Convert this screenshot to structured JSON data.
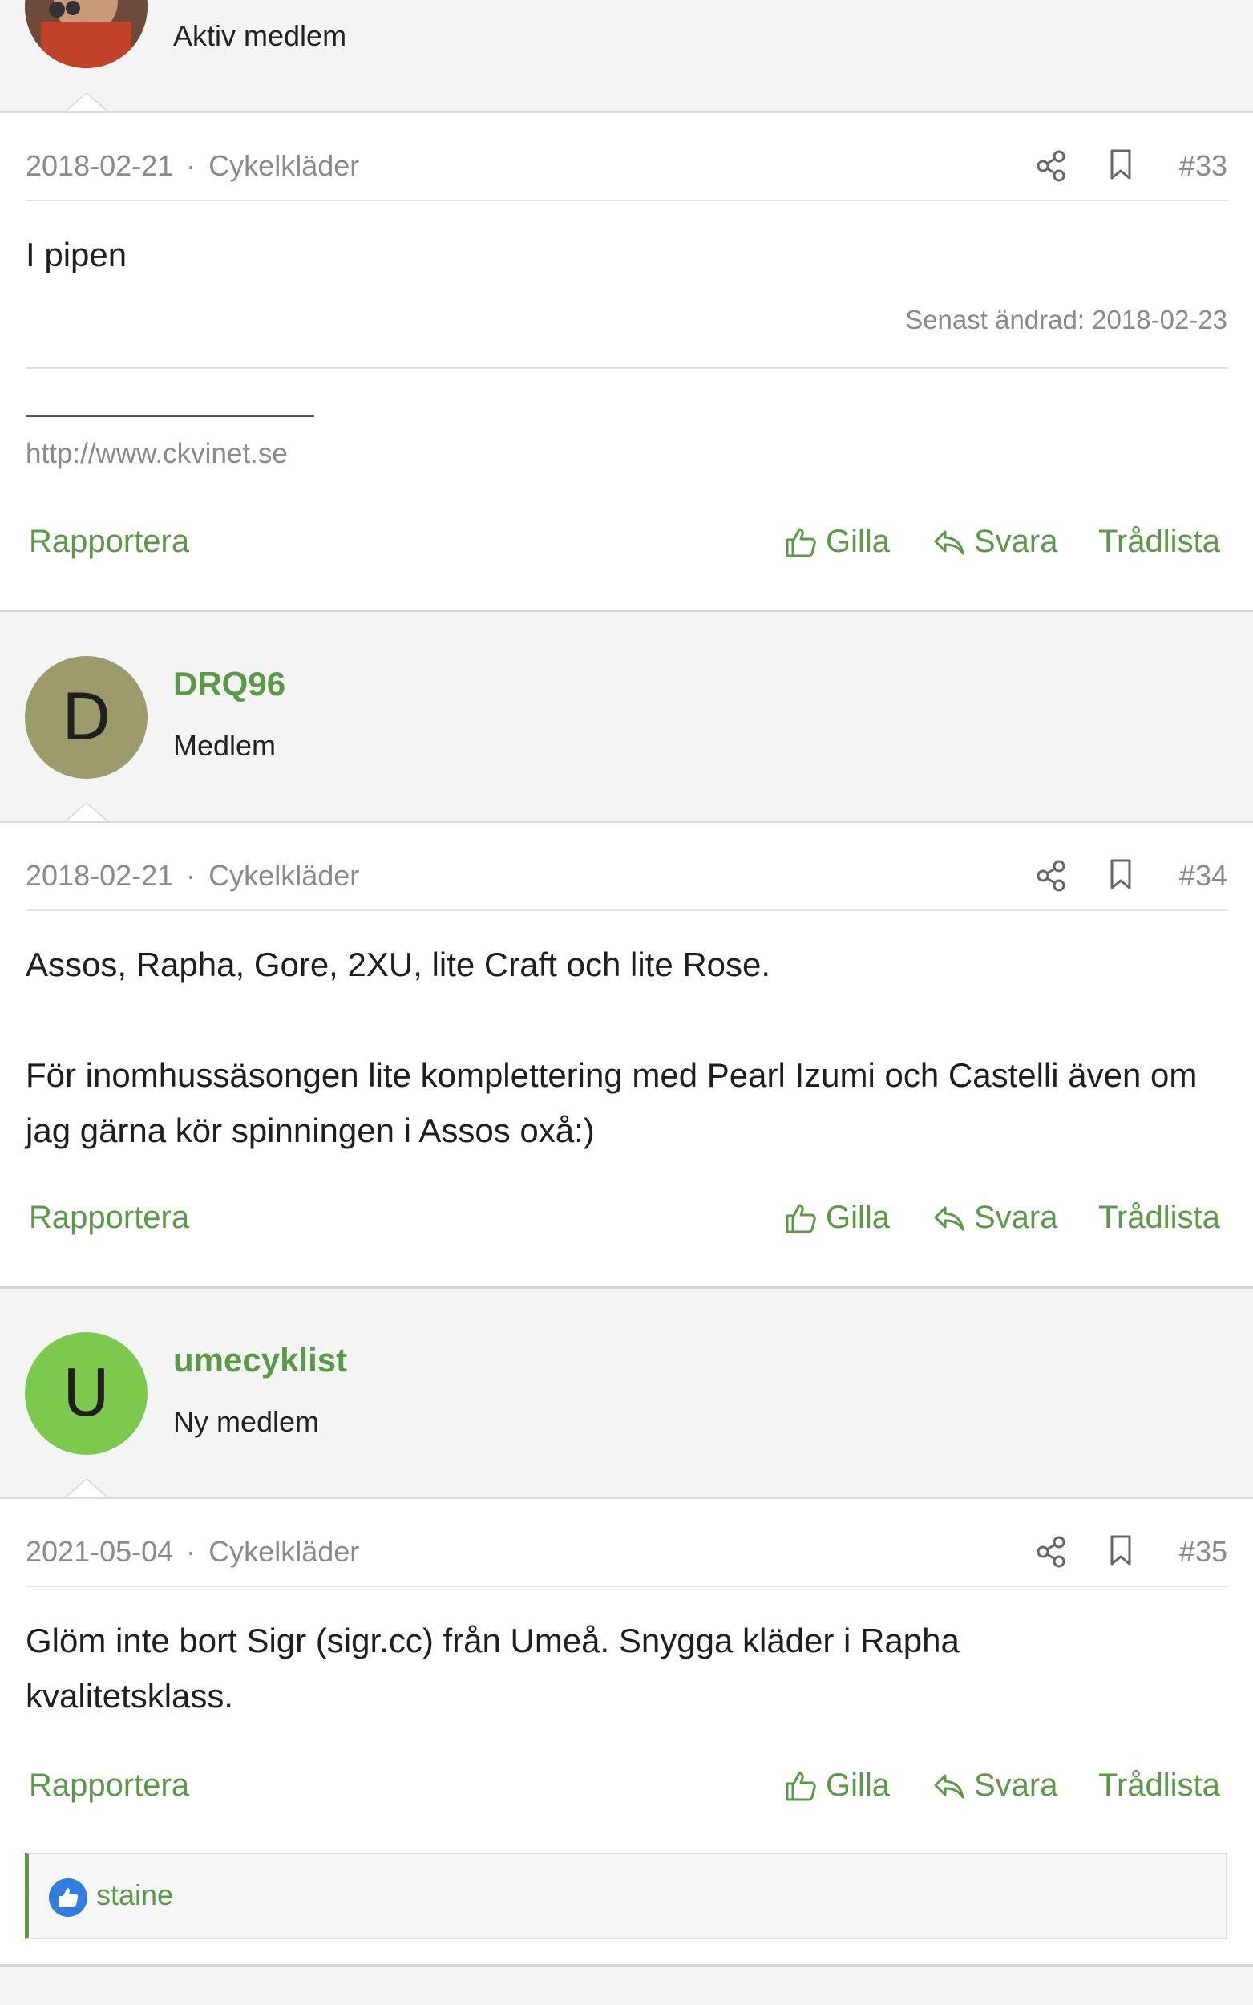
{
  "users": [
    {
      "avatar_letter": "",
      "avatar_color": "#7a3a2a",
      "name": "",
      "role": "Aktiv medlem"
    },
    {
      "avatar_letter": "D",
      "avatar_color": "#9b9b6c",
      "name": "DRQ96",
      "role": "Medlem"
    },
    {
      "avatar_letter": "U",
      "avatar_color": "#7cc94e",
      "name": "umecyklist",
      "role": "Ny medlem"
    }
  ],
  "posts": [
    {
      "date": "2018-02-21",
      "separator": "·",
      "category": "Cykelkläder",
      "number": "#33",
      "paragraphs": [
        "I pipen"
      ],
      "edited": "Senast ändrad: 2018-02-23",
      "signature_link": "http://www.ckvinet.se"
    },
    {
      "date": "2018-02-21",
      "separator": "·",
      "category": "Cykelkläder",
      "number": "#34",
      "paragraphs": [
        "Assos, Rapha, Gore, 2XU, lite Craft och lite Rose.",
        "För inomhussäsongen lite komplettering med Pearl Izumi och Castelli även om jag gärna kör spinningen i Assos oxå:)"
      ]
    },
    {
      "date": "2021-05-04",
      "separator": "·",
      "category": "Cykelkläder",
      "number": "#35",
      "paragraphs": [
        "Glöm inte bort Sigr (sigr.cc) från Umeå. Snygga kläder i Rapha kvalitetsklass."
      ],
      "likes": [
        "staine"
      ]
    }
  ],
  "actions": {
    "report": "Rapportera",
    "like": "Gilla",
    "reply": "Svara",
    "thread_list": "Trådlista"
  },
  "icons": {
    "share": "share-icon",
    "bookmark": "bookmark-icon",
    "like": "thumbs-up-icon",
    "reply": "reply-icon"
  },
  "colors": {
    "accent": "#5a9a47",
    "meta": "#8a8a8a",
    "like_badge": "#2f7de1"
  }
}
